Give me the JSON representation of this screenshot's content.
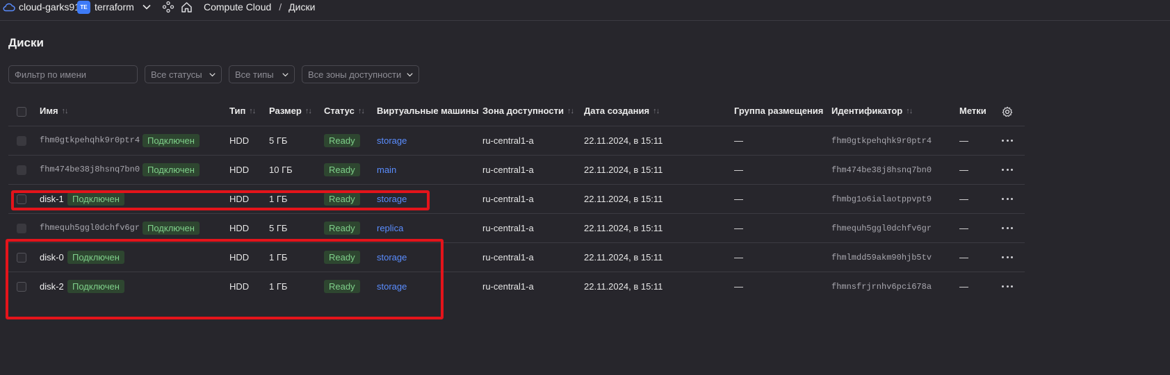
{
  "topbar": {
    "cloud_name": "cloud-garks91",
    "folder_badge": "TE",
    "folder_name": "terraform",
    "service": "Compute Cloud",
    "separator": "/",
    "current_page": "Диски"
  },
  "page": {
    "title": "Диски"
  },
  "filters": {
    "name_placeholder": "Фильтр по имени",
    "status": "Все статусы",
    "type": "Все типы",
    "zone": "Все зоны доступности"
  },
  "columns": {
    "name": "Имя",
    "type": "Тип",
    "size": "Размер",
    "status": "Статус",
    "vms": "Виртуальные машины",
    "zone": "Зона доступности",
    "created": "Дата создания",
    "placement": "Группа размещения",
    "id": "Идентификатор",
    "labels": "Метки",
    "sort_glyph": "↑↓"
  },
  "rows": [
    {
      "name": "fhm0gtkpehqhk9r0ptr4",
      "badge": "Подключен",
      "type": "HDD",
      "size": "5 ГБ",
      "status": "Ready",
      "vm": "storage",
      "zone": "ru-central1-a",
      "created": "22.11.2024, в 15:11",
      "placement": "—",
      "id": "fhm0gtkpehqhk9r0ptr4",
      "labels": "—"
    },
    {
      "name": "fhm474be38j8hsnq7bn0",
      "badge": "Подключен",
      "type": "HDD",
      "size": "10 ГБ",
      "status": "Ready",
      "vm": "main",
      "zone": "ru-central1-a",
      "created": "22.11.2024, в 15:11",
      "placement": "—",
      "id": "fhm474be38j8hsnq7bn0",
      "labels": "—"
    },
    {
      "name": "disk-1",
      "badge": "Подключен",
      "type": "HDD",
      "size": "1 ГБ",
      "status": "Ready",
      "vm": "storage",
      "zone": "ru-central1-a",
      "created": "22.11.2024, в 15:11",
      "placement": "—",
      "id": "fhmbg1o6ialaotppvpt9",
      "labels": "—"
    },
    {
      "name": "fhmequh5ggl0dchfv6gr",
      "badge": "Подключен",
      "type": "HDD",
      "size": "5 ГБ",
      "status": "Ready",
      "vm": "replica",
      "zone": "ru-central1-a",
      "created": "22.11.2024, в 15:11",
      "placement": "—",
      "id": "fhmequh5ggl0dchfv6gr",
      "labels": "—"
    },
    {
      "name": "disk-0",
      "badge": "Подключен",
      "type": "HDD",
      "size": "1 ГБ",
      "status": "Ready",
      "vm": "storage",
      "zone": "ru-central1-a",
      "created": "22.11.2024, в 15:11",
      "placement": "—",
      "id": "fhmlmdd59akm90hjb5tv",
      "labels": "—"
    },
    {
      "name": "disk-2",
      "badge": "Подключен",
      "type": "HDD",
      "size": "1 ГБ",
      "status": "Ready",
      "vm": "storage",
      "zone": "ru-central1-a",
      "created": "22.11.2024, в 15:11",
      "placement": "—",
      "id": "fhmnsfrjrnhv6pci678a",
      "labels": "—"
    }
  ],
  "colors": {
    "background": "#27262c",
    "badge_green_bg": "#2e4630",
    "badge_green_text": "#7fd08a",
    "link": "#5a8dff",
    "highlight_box": "#e3141b",
    "folder_badge": "#3e7bf7"
  },
  "icons": [
    "cloud-icon",
    "chevron-down-icon",
    "services-icon",
    "home-icon",
    "settings-gear-icon",
    "more-actions-icon"
  ]
}
